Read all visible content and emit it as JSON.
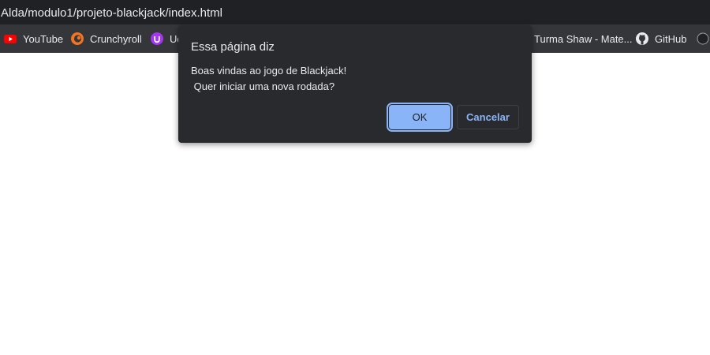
{
  "browser": {
    "url": "Alda/modulo1/projeto-blackjack/index.html",
    "bookmarks": [
      {
        "label": "YouTube",
        "icon": "youtube-icon"
      },
      {
        "label": "Crunchyroll",
        "icon": "crunchyroll-icon"
      },
      {
        "label": "Ud",
        "icon": "udemy-icon"
      },
      {
        "label": "Turma Shaw - Mate...",
        "icon": "labenu-icon"
      },
      {
        "label": "GitHub",
        "icon": "github-icon"
      }
    ]
  },
  "dialog": {
    "title": "Essa página diz",
    "message": "Boas vindas ao jogo de Blackjack!\n Quer iniciar uma nova rodada?",
    "ok_label": "OK",
    "cancel_label": "Cancelar"
  },
  "colors": {
    "toolbar_bg": "#202124",
    "bookmarks_bg": "#35363a",
    "dialog_bg": "#292a2d",
    "accent": "#8ab4f8"
  }
}
